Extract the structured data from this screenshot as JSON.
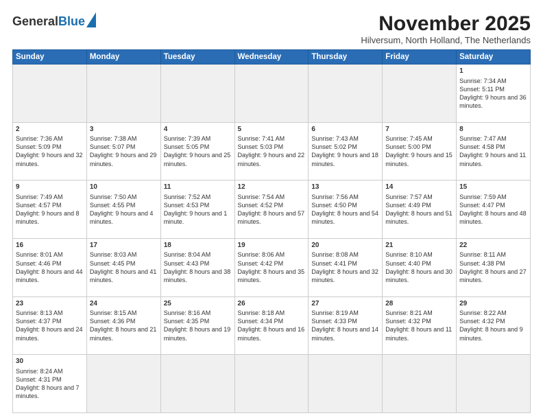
{
  "header": {
    "logo_general": "General",
    "logo_blue": "Blue",
    "title": "November 2025",
    "location": "Hilversum, North Holland, The Netherlands"
  },
  "days_of_week": [
    "Sunday",
    "Monday",
    "Tuesday",
    "Wednesday",
    "Thursday",
    "Friday",
    "Saturday"
  ],
  "weeks": [
    [
      {
        "day": "",
        "info": ""
      },
      {
        "day": "",
        "info": ""
      },
      {
        "day": "",
        "info": ""
      },
      {
        "day": "",
        "info": ""
      },
      {
        "day": "",
        "info": ""
      },
      {
        "day": "",
        "info": ""
      },
      {
        "day": "1",
        "info": "Sunrise: 7:34 AM\nSunset: 5:11 PM\nDaylight: 9 hours\nand 36 minutes."
      }
    ],
    [
      {
        "day": "2",
        "info": "Sunrise: 7:36 AM\nSunset: 5:09 PM\nDaylight: 9 hours\nand 32 minutes."
      },
      {
        "day": "3",
        "info": "Sunrise: 7:38 AM\nSunset: 5:07 PM\nDaylight: 9 hours\nand 29 minutes."
      },
      {
        "day": "4",
        "info": "Sunrise: 7:39 AM\nSunset: 5:05 PM\nDaylight: 9 hours\nand 25 minutes."
      },
      {
        "day": "5",
        "info": "Sunrise: 7:41 AM\nSunset: 5:03 PM\nDaylight: 9 hours\nand 22 minutes."
      },
      {
        "day": "6",
        "info": "Sunrise: 7:43 AM\nSunset: 5:02 PM\nDaylight: 9 hours\nand 18 minutes."
      },
      {
        "day": "7",
        "info": "Sunrise: 7:45 AM\nSunset: 5:00 PM\nDaylight: 9 hours\nand 15 minutes."
      },
      {
        "day": "8",
        "info": "Sunrise: 7:47 AM\nSunset: 4:58 PM\nDaylight: 9 hours\nand 11 minutes."
      }
    ],
    [
      {
        "day": "9",
        "info": "Sunrise: 7:49 AM\nSunset: 4:57 PM\nDaylight: 9 hours\nand 8 minutes."
      },
      {
        "day": "10",
        "info": "Sunrise: 7:50 AM\nSunset: 4:55 PM\nDaylight: 9 hours\nand 4 minutes."
      },
      {
        "day": "11",
        "info": "Sunrise: 7:52 AM\nSunset: 4:53 PM\nDaylight: 9 hours\nand 1 minute."
      },
      {
        "day": "12",
        "info": "Sunrise: 7:54 AM\nSunset: 4:52 PM\nDaylight: 8 hours\nand 57 minutes."
      },
      {
        "day": "13",
        "info": "Sunrise: 7:56 AM\nSunset: 4:50 PM\nDaylight: 8 hours\nand 54 minutes."
      },
      {
        "day": "14",
        "info": "Sunrise: 7:57 AM\nSunset: 4:49 PM\nDaylight: 8 hours\nand 51 minutes."
      },
      {
        "day": "15",
        "info": "Sunrise: 7:59 AM\nSunset: 4:47 PM\nDaylight: 8 hours\nand 48 minutes."
      }
    ],
    [
      {
        "day": "16",
        "info": "Sunrise: 8:01 AM\nSunset: 4:46 PM\nDaylight: 8 hours\nand 44 minutes."
      },
      {
        "day": "17",
        "info": "Sunrise: 8:03 AM\nSunset: 4:45 PM\nDaylight: 8 hours\nand 41 minutes."
      },
      {
        "day": "18",
        "info": "Sunrise: 8:04 AM\nSunset: 4:43 PM\nDaylight: 8 hours\nand 38 minutes."
      },
      {
        "day": "19",
        "info": "Sunrise: 8:06 AM\nSunset: 4:42 PM\nDaylight: 8 hours\nand 35 minutes."
      },
      {
        "day": "20",
        "info": "Sunrise: 8:08 AM\nSunset: 4:41 PM\nDaylight: 8 hours\nand 32 minutes."
      },
      {
        "day": "21",
        "info": "Sunrise: 8:10 AM\nSunset: 4:40 PM\nDaylight: 8 hours\nand 30 minutes."
      },
      {
        "day": "22",
        "info": "Sunrise: 8:11 AM\nSunset: 4:38 PM\nDaylight: 8 hours\nand 27 minutes."
      }
    ],
    [
      {
        "day": "23",
        "info": "Sunrise: 8:13 AM\nSunset: 4:37 PM\nDaylight: 8 hours\nand 24 minutes."
      },
      {
        "day": "24",
        "info": "Sunrise: 8:15 AM\nSunset: 4:36 PM\nDaylight: 8 hours\nand 21 minutes."
      },
      {
        "day": "25",
        "info": "Sunrise: 8:16 AM\nSunset: 4:35 PM\nDaylight: 8 hours\nand 19 minutes."
      },
      {
        "day": "26",
        "info": "Sunrise: 8:18 AM\nSunset: 4:34 PM\nDaylight: 8 hours\nand 16 minutes."
      },
      {
        "day": "27",
        "info": "Sunrise: 8:19 AM\nSunset: 4:33 PM\nDaylight: 8 hours\nand 14 minutes."
      },
      {
        "day": "28",
        "info": "Sunrise: 8:21 AM\nSunset: 4:32 PM\nDaylight: 8 hours\nand 11 minutes."
      },
      {
        "day": "29",
        "info": "Sunrise: 8:22 AM\nSunset: 4:32 PM\nDaylight: 8 hours\nand 9 minutes."
      }
    ],
    [
      {
        "day": "30",
        "info": "Sunrise: 8:24 AM\nSunset: 4:31 PM\nDaylight: 8 hours\nand 7 minutes."
      },
      {
        "day": "",
        "info": ""
      },
      {
        "day": "",
        "info": ""
      },
      {
        "day": "",
        "info": ""
      },
      {
        "day": "",
        "info": ""
      },
      {
        "day": "",
        "info": ""
      },
      {
        "day": "",
        "info": ""
      }
    ]
  ]
}
